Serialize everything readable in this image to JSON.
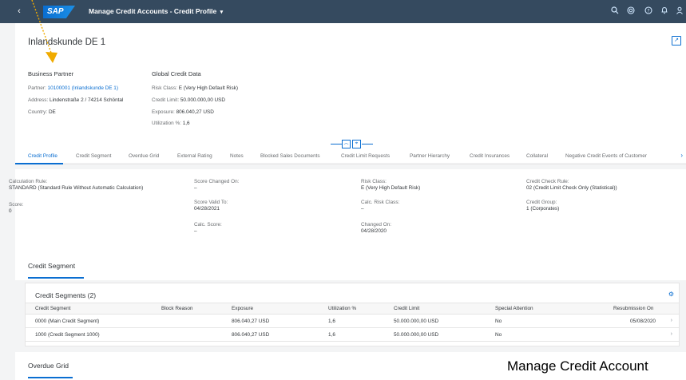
{
  "shell": {
    "logo": "SAP",
    "app_title": "Manage Credit Accounts - Credit Profile",
    "caret": "▾",
    "back_glyph": "‹",
    "icons": [
      "search-icon",
      "copilot-icon",
      "help-icon",
      "notifications-icon",
      "user-icon"
    ]
  },
  "header": {
    "title": "Inlandskunde DE 1",
    "business_partner": {
      "title": "Business Partner",
      "partner_label": "Partner:",
      "partner_value": "10100001 (Inlandskunde DE 1)",
      "address_label": "Address:",
      "address_value": "Lindenstraße 2 / 74214 Schöntal",
      "country_label": "Country:",
      "country_value": "DE"
    },
    "global_credit": {
      "title": "Global Credit Data",
      "risk_label": "Risk Class:",
      "risk_value": "E (Very High Default Risk)",
      "limit_label": "Credit Limit:",
      "limit_value": "50.000.000,00 USD",
      "exposure_label": "Exposure:",
      "exposure_value": "806.040,27 USD",
      "util_label": "Utilization %:",
      "util_value": "1,6"
    }
  },
  "tabs": [
    "Credit Profile",
    "Credit Segment",
    "Overdue Grid",
    "External Rating",
    "Notes",
    "Blocked Sales Documents",
    "Credit Limit Requests",
    "Partner Hierarchy",
    "Credit Insurances",
    "Collateral",
    "Negative Credit Events of Customer"
  ],
  "profile": {
    "calc_rule_label": "Calculation Rule:",
    "calc_rule_value": "STANDARD (Standard Rule Without Automatic Calculation)",
    "score_label": "Score:",
    "score_value": "0",
    "score_changed_label": "Score Changed On:",
    "score_changed_value": "–",
    "score_valid_label": "Score Valid To:",
    "score_valid_value": "04/28/2021",
    "calc_score_label": "Calc. Score:",
    "calc_score_value": "–",
    "risk_label": "Risk Class:",
    "risk_value": "E (Very High Default Risk)",
    "calc_risk_label": "Calc. Risk Class:",
    "calc_risk_value": "–",
    "changed_label": "Changed On:",
    "changed_value": "04/28/2020",
    "check_rule_label": "Credit Check Rule:",
    "check_rule_value": "02 (Credit Limit Check Only (Statistical))",
    "group_label": "Credit Group:",
    "group_value": "1 (Corporates)"
  },
  "segment_section": {
    "title": "Credit Segment",
    "table_title": "Credit Segments (2)",
    "columns": [
      "Credit Segment",
      "Block Reason",
      "Exposure",
      "Utilization %",
      "Credit Limit",
      "Special Attention",
      "Resubmission On"
    ],
    "rows": [
      [
        "0000 (Main Credit Segment)",
        "",
        "806.040,27  USD",
        "1,6",
        "50.000.000,00  USD",
        "No",
        "05/08/2020"
      ],
      [
        "1000 (Credit Segment 1000)",
        "",
        "806.040,27  USD",
        "1,6",
        "50.000.000,00  USD",
        "No",
        ""
      ]
    ]
  },
  "overdue": {
    "title": "Overdue Grid"
  },
  "caption": "Manage Credit Account",
  "colors": {
    "shell": "#354a5f",
    "accent": "#0a6ed1",
    "annotation": "#f0ab00"
  }
}
